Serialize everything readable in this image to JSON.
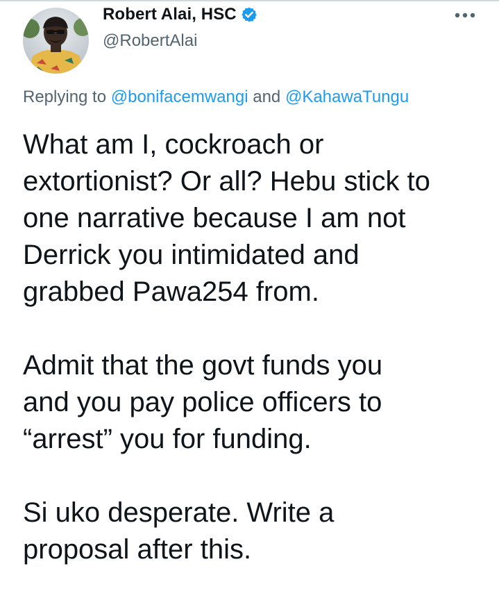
{
  "author": {
    "display_name": "Robert Alai, HSC",
    "handle": "@RobertAlai",
    "verified": true,
    "avatar_icon": "profile-photo"
  },
  "more_menu": {
    "icon": "more-horizontal-icon"
  },
  "reply_context": {
    "prefix": "Replying to",
    "mentions": [
      "@bonifacemwangi",
      "@KahawaTungu"
    ],
    "joiner": "and"
  },
  "tweet": {
    "paragraphs": [
      {
        "lines": [
          "What am I, cockroach or",
          "extortionist? Or all? Hebu stick to",
          "one narrative because I am not",
          "Derrick you intimidated and",
          "grabbed Pawa254 from."
        ]
      },
      {
        "lines": [
          "Admit that the govt funds you",
          "and you pay police officers to",
          "“arrest” you for funding."
        ]
      },
      {
        "lines": [
          "Si uko desperate. Write a",
          "proposal after this."
        ]
      }
    ]
  },
  "colors": {
    "text_primary": "#0f1419",
    "text_secondary": "#536471",
    "accent": "#1d9bf0"
  }
}
